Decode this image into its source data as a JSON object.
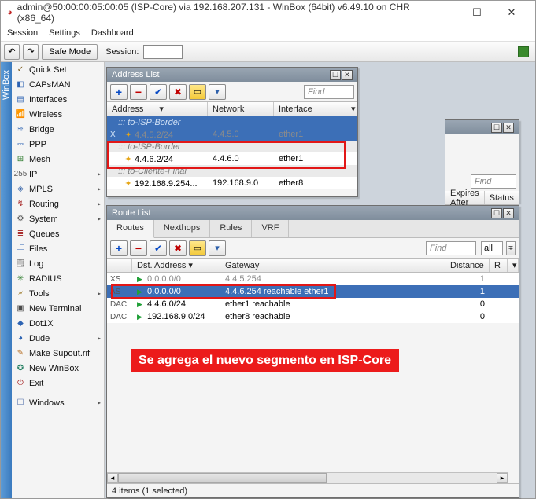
{
  "titlebar": {
    "text": "admin@50:00:00:05:00:05 (ISP-Core) via 192.168.207.131 - WinBox (64bit) v6.49.10 on CHR (x86_64)"
  },
  "menubar": {
    "session": "Session",
    "settings": "Settings",
    "dashboard": "Dashboard"
  },
  "toolbar": {
    "safemode": "Safe Mode",
    "session_label": "Session:"
  },
  "vtab": "WinBox",
  "sidebar": [
    {
      "icon": "✓",
      "label": "Quick Set",
      "sub": false,
      "c": "#7d5b1a"
    },
    {
      "icon": "◧",
      "label": "CAPsMAN",
      "sub": false,
      "c": "#2e64b3"
    },
    {
      "icon": "▤",
      "label": "Interfaces",
      "sub": false,
      "c": "#2e64b3"
    },
    {
      "icon": "📶",
      "label": "Wireless",
      "sub": false,
      "c": "#2e64b3"
    },
    {
      "icon": "≋",
      "label": "Bridge",
      "sub": false,
      "c": "#2e64b3"
    },
    {
      "icon": "⎓",
      "label": "PPP",
      "sub": false,
      "c": "#2e64b3"
    },
    {
      "icon": "⊞",
      "label": "Mesh",
      "sub": false,
      "c": "#2a7a2a"
    },
    {
      "icon": "255",
      "label": "IP",
      "sub": true,
      "c": "#5a5a5a"
    },
    {
      "icon": "◈",
      "label": "MPLS",
      "sub": true,
      "c": "#3a67aa"
    },
    {
      "icon": "↯",
      "label": "Routing",
      "sub": true,
      "c": "#aa2f2f"
    },
    {
      "icon": "⚙",
      "label": "System",
      "sub": true,
      "c": "#5a5a5a"
    },
    {
      "icon": "≣",
      "label": "Queues",
      "sub": false,
      "c": "#aa2f2f"
    },
    {
      "icon": "🗀",
      "label": "Files",
      "sub": false,
      "c": "#2e64b3"
    },
    {
      "icon": "🗒",
      "label": "Log",
      "sub": false,
      "c": "#7a7a7a"
    },
    {
      "icon": "✳",
      "label": "RADIUS",
      "sub": false,
      "c": "#2a7a2a"
    },
    {
      "icon": "🗲",
      "label": "Tools",
      "sub": true,
      "c": "#9a7521"
    },
    {
      "icon": "▣",
      "label": "New Terminal",
      "sub": false,
      "c": "#4a4a4a"
    },
    {
      "icon": "◆",
      "label": "Dot1X",
      "sub": false,
      "c": "#2e64b3"
    },
    {
      "icon": "◕",
      "label": "Dude",
      "sub": true,
      "c": "#2e64b3"
    },
    {
      "icon": "✎",
      "label": "Make Supout.rif",
      "sub": false,
      "c": "#b56b1d"
    },
    {
      "icon": "✪",
      "label": "New WinBox",
      "sub": false,
      "c": "#2a8366"
    },
    {
      "icon": "⏻",
      "label": "Exit",
      "sub": false,
      "c": "#aa2f2f"
    },
    {
      "icon": "☐",
      "label": "Windows",
      "sub": true,
      "c": "#4a6aa8",
      "gap": true
    }
  ],
  "addr_win": {
    "title": "Address List",
    "find": "Find",
    "headers": {
      "address": "Address",
      "network": "Network",
      "interface": "Interface"
    },
    "groups": [
      {
        "label": "::: to-ISP-Border",
        "rows": [
          {
            "flag": "X",
            "addr": "4.4.5.2/24",
            "net": "4.4.5.0",
            "if": "ether1",
            "dim": true
          }
        ]
      },
      {
        "label": "::: to-ISP-Border",
        "rows": [
          {
            "flag": "",
            "addr": "4.4.6.2/24",
            "net": "4.4.6.0",
            "if": "ether1",
            "dim": false
          }
        ]
      },
      {
        "label": "::: to-Cliente-Final",
        "rows": [
          {
            "flag": "",
            "addr": "192.168.9.254...",
            "net": "192.168.9.0",
            "if": "ether8",
            "dim": false
          }
        ]
      }
    ]
  },
  "bg_win": {
    "find": "Find",
    "headers": {
      "expires": "Expires After",
      "status": "Status"
    }
  },
  "route_win": {
    "title": "Route List",
    "tabs": {
      "routes": "Routes",
      "nexthops": "Nexthops",
      "rules": "Rules",
      "vrf": "VRF"
    },
    "find": "Find",
    "all": "all",
    "headers": {
      "dst": "Dst. Address",
      "gw": "Gateway",
      "dist": "Distance",
      "r": "R"
    },
    "rows": [
      {
        "flag": "XS",
        "dst": "0.0.0.0/0",
        "gw": "4.4.5.254",
        "dist": "1",
        "sel": false,
        "dim": true
      },
      {
        "flag": "AS",
        "dst": "0.0.0.0/0",
        "gw": "4.4.6.254 reachable ether1",
        "dist": "1",
        "sel": true,
        "dim": false
      },
      {
        "flag": "DAC",
        "dst": "4.4.6.0/24",
        "gw": "ether1 reachable",
        "dist": "0",
        "sel": false,
        "dim": false
      },
      {
        "flag": "DAC",
        "dst": "192.168.9.0/24",
        "gw": "ether8 reachable",
        "dist": "0",
        "sel": false,
        "dim": false
      }
    ],
    "status": "4 items (1 selected)"
  },
  "annotation": "Se agrega el nuevo segmento en ISP-Core"
}
